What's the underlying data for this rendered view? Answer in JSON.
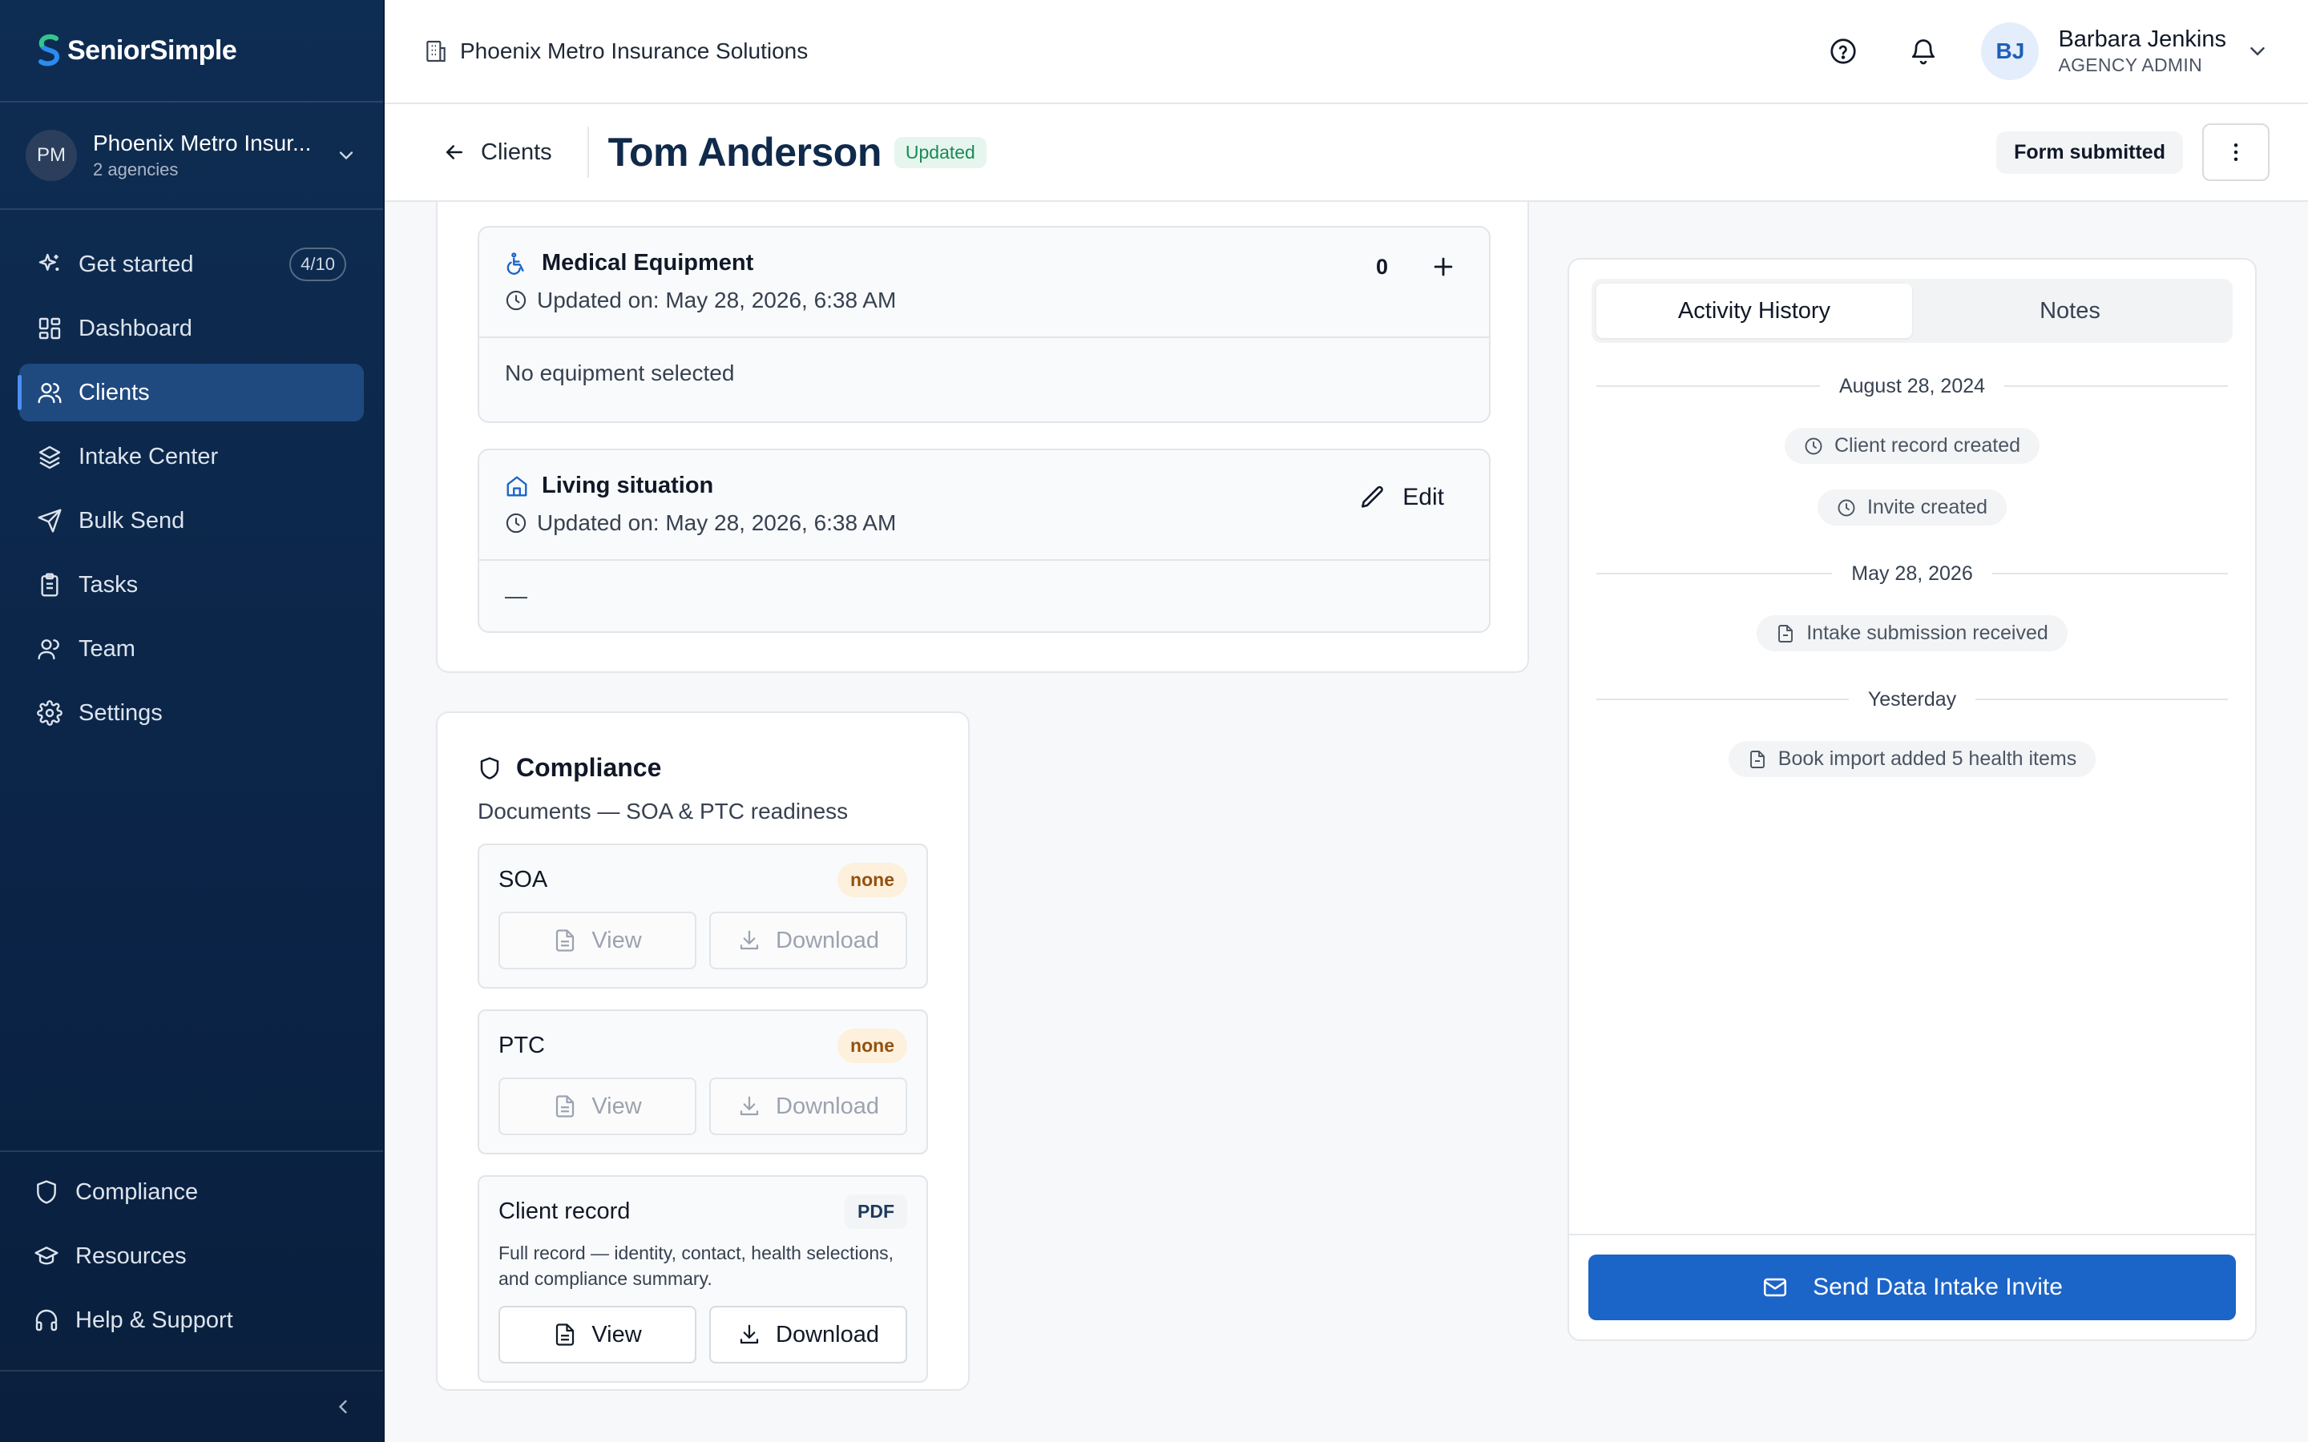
{
  "brand": {
    "name": "SeniorSimple"
  },
  "org_switcher": {
    "initials": "PM",
    "name": "Phoenix Metro Insur...",
    "sub": "2 agencies"
  },
  "nav": {
    "items": [
      {
        "label": "Get started",
        "icon": "sparkle-icon",
        "badge": "4/10"
      },
      {
        "label": "Dashboard",
        "icon": "grid-icon"
      },
      {
        "label": "Clients",
        "icon": "users-icon",
        "active": true
      },
      {
        "label": "Intake Center",
        "icon": "layers-icon"
      },
      {
        "label": "Bulk Send",
        "icon": "send-icon"
      },
      {
        "label": "Tasks",
        "icon": "clipboard-icon"
      },
      {
        "label": "Team",
        "icon": "team-icon"
      },
      {
        "label": "Settings",
        "icon": "gear-icon"
      }
    ],
    "bottom": [
      {
        "label": "Compliance",
        "icon": "shield-icon"
      },
      {
        "label": "Resources",
        "icon": "graduation-cap-icon"
      },
      {
        "label": "Help & Support",
        "icon": "headset-icon"
      }
    ]
  },
  "topbar": {
    "org_name": "Phoenix Metro Insurance Solutions",
    "user": {
      "initials": "BJ",
      "name": "Barbara Jenkins",
      "role": "AGENCY ADMIN"
    }
  },
  "header": {
    "back_label": "Clients",
    "client_name": "Tom Anderson",
    "status_badge": "Updated",
    "form_status": "Form submitted"
  },
  "sections": {
    "medical_equipment": {
      "title": "Medical Equipment",
      "updated": "Updated on: May 28, 2026, 6:38 AM",
      "count": "0",
      "body": "No equipment selected"
    },
    "living_situation": {
      "title": "Living situation",
      "updated": "Updated on: May 28, 2026, 6:38 AM",
      "edit_label": "Edit",
      "body": "—"
    }
  },
  "compliance": {
    "title": "Compliance",
    "subtitle": "Documents — SOA & PTC readiness",
    "documents": [
      {
        "name": "SOA",
        "status": "none",
        "view": "View",
        "download": "Download"
      },
      {
        "name": "PTC",
        "status": "none",
        "view": "View",
        "download": "Download"
      },
      {
        "name": "Client record",
        "status": "PDF",
        "description": "Full record — identity, contact, health selections, and compliance summary.",
        "view": "View",
        "download": "Download"
      }
    ]
  },
  "activity": {
    "tabs": [
      "Activity History",
      "Notes"
    ],
    "groups": [
      {
        "date": "August 28, 2024",
        "events": [
          {
            "text": "Client record created",
            "icon": "clock-icon"
          },
          {
            "text": "Invite created",
            "icon": "clock-icon"
          }
        ]
      },
      {
        "date": "May 28, 2026",
        "events": [
          {
            "text": "Intake submission received",
            "icon": "document-icon"
          }
        ]
      },
      {
        "date": "Yesterday",
        "events": [
          {
            "text": "Book import added 5 health items",
            "icon": "document-icon"
          }
        ]
      }
    ],
    "send_button": "Send Data Intake Invite"
  },
  "colors": {
    "sidebar": "#0e2d52",
    "accent": "#1b64c8",
    "updated_badge": "#1a8a55"
  }
}
